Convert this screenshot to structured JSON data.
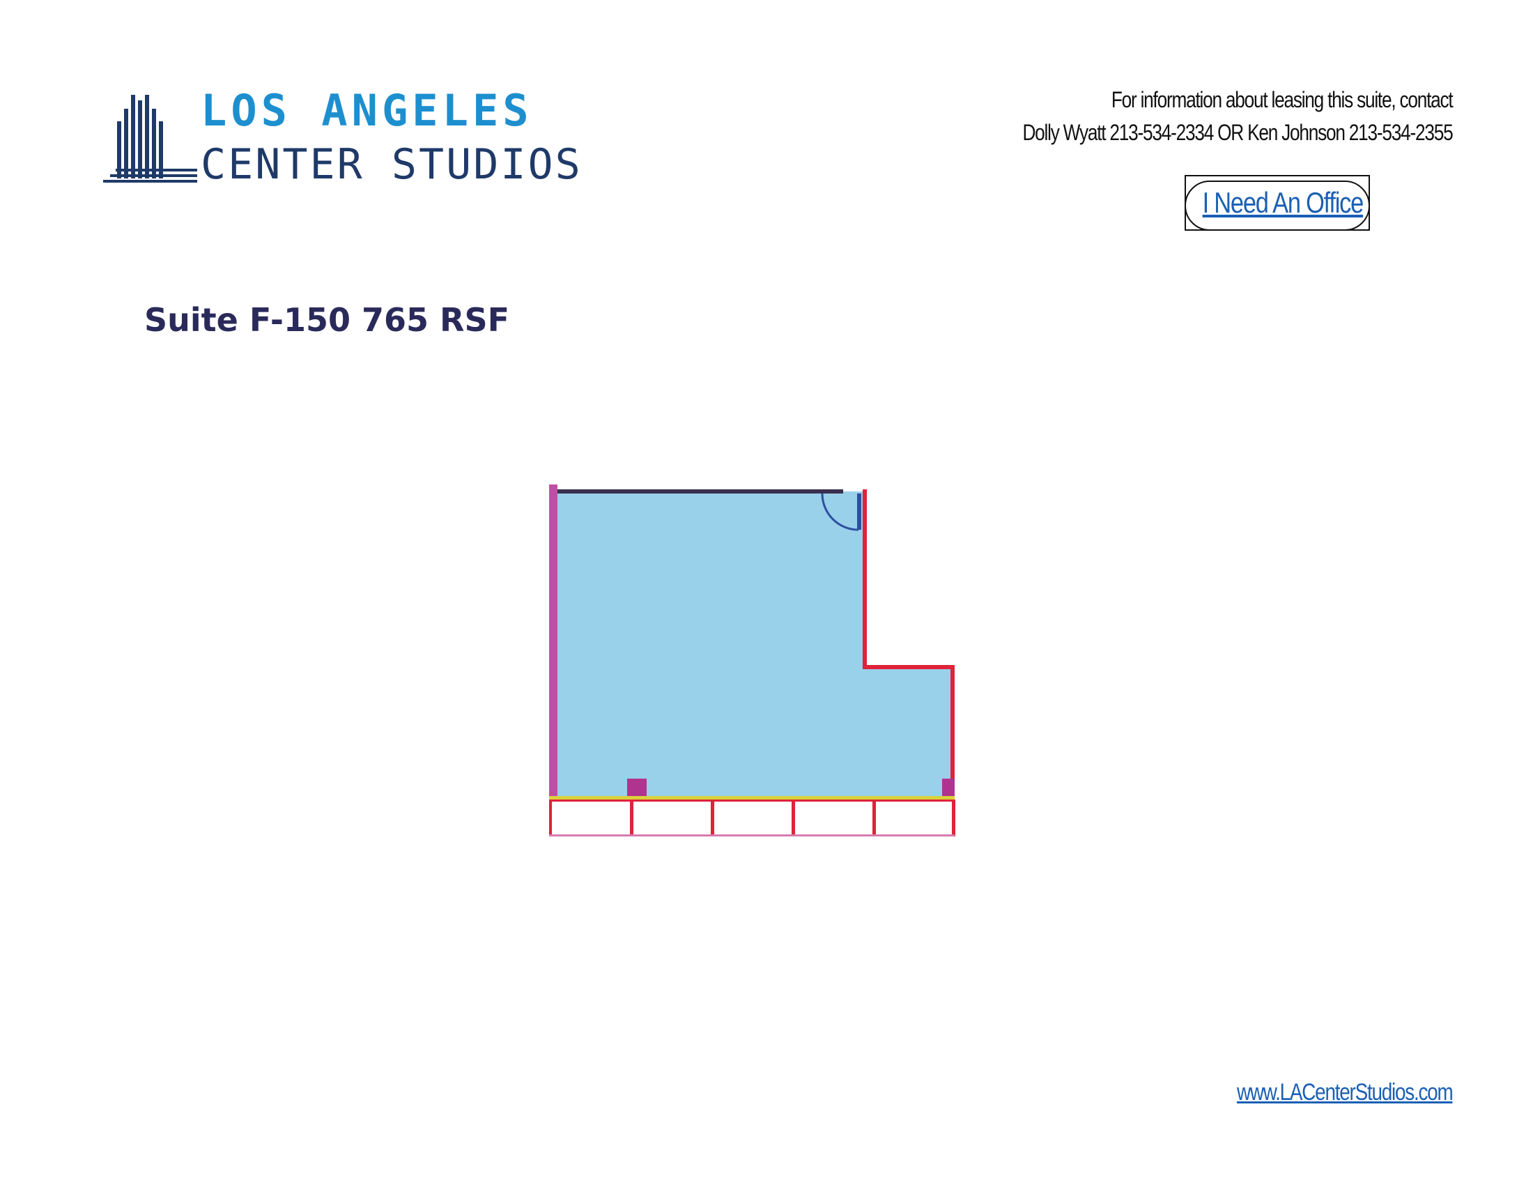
{
  "logo": {
    "line1": "LOS ANGELES",
    "line2": "CENTER STUDIOS",
    "colors": {
      "primary": "#1d8fcf",
      "secondary": "#1f3a68"
    }
  },
  "contact": {
    "line1": "For information about leasing this suite, contact",
    "line2": "Dolly Wyatt 213-534-2334  OR   Ken Johnson 213-534-2355"
  },
  "cta": {
    "label": "I Need An Office"
  },
  "suite": {
    "title": "Suite F-150  765 RSF"
  },
  "floor_plan": {
    "fill_color": "#99d0ea",
    "wall_color": "#e0223a",
    "accent_wall_color": "#c04fa3"
  },
  "footer": {
    "website": "www.LACenterStudios.com"
  }
}
